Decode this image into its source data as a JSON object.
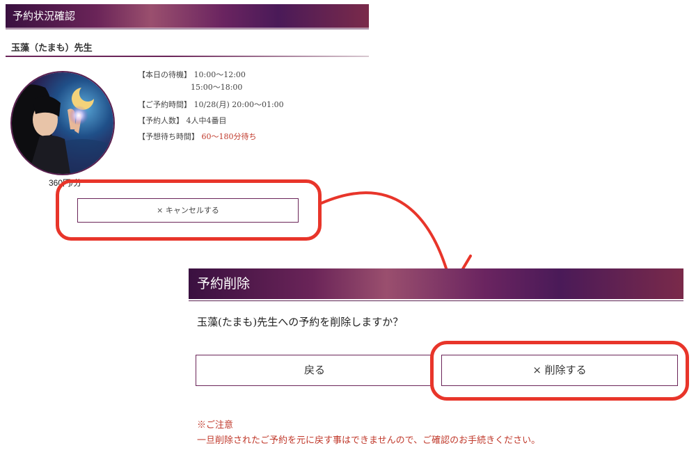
{
  "status_panel": {
    "header": "予約状況確認",
    "teacher_name": "玉藻（たまも）先生",
    "price": "360円/分",
    "info": {
      "wait_label": "【本日の待機】",
      "wait_times": [
        "10:00〜12:00",
        "15:00〜18:00"
      ],
      "reserve_time_label": "【ご予約時間】",
      "reserve_time": "10/28(月) 20:00〜01:00",
      "count_label": "【予約人数】",
      "count": "4人中4番目",
      "expected_label": "【予想待ち時間】",
      "expected": "60〜180分待ち"
    },
    "cancel_button": "× キャンセルする"
  },
  "dialog": {
    "header": "予約削除",
    "question": "玉藻(たまも)先生への予約を削除しますか？",
    "back_button": "戻る",
    "delete_button": "× 削除する",
    "notice_title": "※ご注意",
    "notice_body": "一旦削除されたご予約を元に戻す事はできませんので、ご確認のお手続きください。"
  },
  "colors": {
    "accent": "#6a2458",
    "highlight": "#e8352a",
    "warning_text": "#c0392b"
  }
}
